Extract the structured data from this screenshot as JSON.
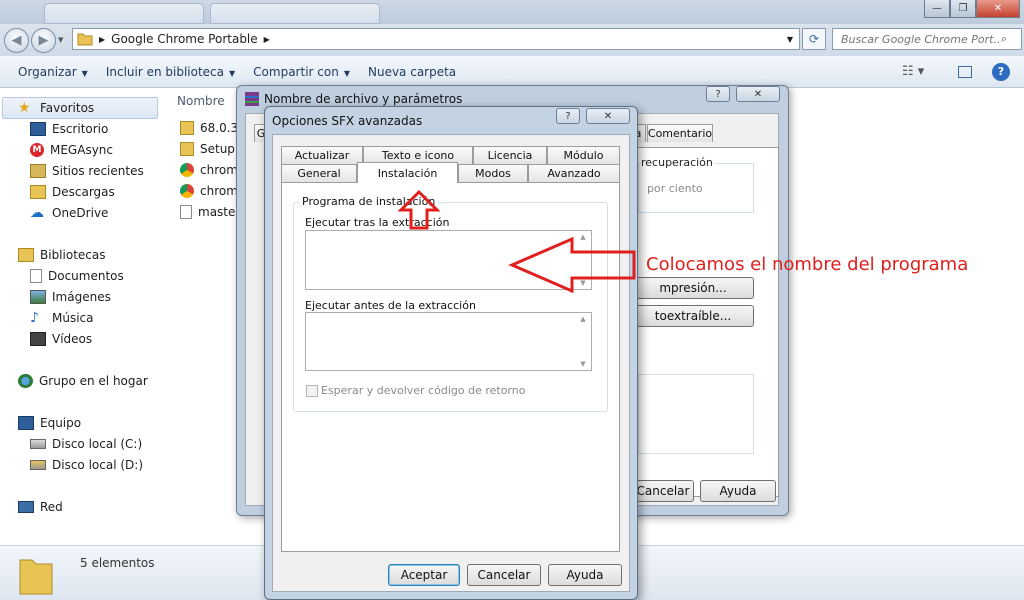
{
  "window": {
    "address": "Google Chrome Portable",
    "search_placeholder": "Buscar Google Chrome Port...",
    "minimize": "—",
    "maximize": "❐",
    "close": "✕"
  },
  "toolbar": {
    "organize": "Organizar",
    "include_library": "Incluir en biblioteca",
    "share": "Compartir con",
    "new_folder": "Nueva carpeta"
  },
  "sidebar": {
    "favorites": "Favoritos",
    "fav_items": [
      "Escritorio",
      "MEGAsync",
      "Sitios recientes",
      "Descargas",
      "OneDrive"
    ],
    "libraries": "Bibliotecas",
    "lib_items": [
      "Documentos",
      "Imágenes",
      "Música",
      "Vídeos"
    ],
    "homegroup": "Grupo en el hogar",
    "computer": "Equipo",
    "comp_items": [
      "Disco local (C:)",
      "Disco local (D:)"
    ],
    "network": "Red"
  },
  "files": {
    "column_name": "Nombre",
    "items": [
      "68.0.34",
      "SetupM",
      "chrome",
      "chrome",
      "master"
    ]
  },
  "status": {
    "count": "5 elementos"
  },
  "winrar": {
    "title": "Nombre de archivo y parámetros",
    "help": "?",
    "close": "✕",
    "tab_g": "G",
    "tab_a": "a",
    "tab_comment": "Comentario",
    "recovery": "recuperación",
    "percent": "por ciento",
    "compression_btn": "mpresión...",
    "selfextract_btn": "toextraíble...",
    "cancel": "Cancelar",
    "help_btn": "Ayuda"
  },
  "sfx": {
    "title": "Opciones SFX avanzadas",
    "help": "?",
    "close": "✕",
    "tabs_row1": [
      "Actualizar",
      "Texto e icono",
      "Licencia",
      "Módulo"
    ],
    "tabs_row2": [
      "General",
      "Instalación",
      "Modos",
      "Avanzado"
    ],
    "group_label": "Programa de instalación",
    "run_after_label": "Ejecutar tras la extracción",
    "run_before_label": "Ejecutar antes de la extracción",
    "wait_label": "Esperar y devolver código de retorno",
    "accept": "Aceptar",
    "cancel": "Cancelar",
    "help_btn": "Ayuda"
  },
  "annotation": {
    "text": "Colocamos el nombre del programa",
    "color": "#e0201f"
  }
}
